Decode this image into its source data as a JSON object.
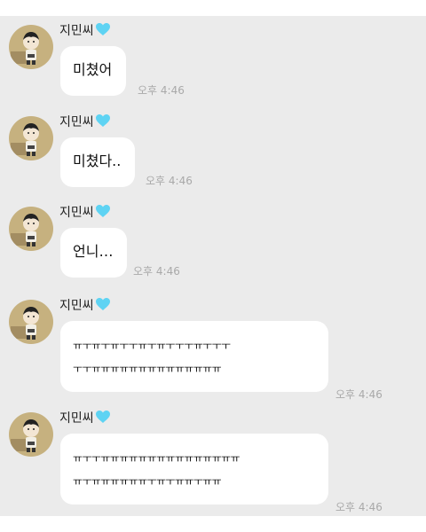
{
  "messages": [
    {
      "sender": "지민씨",
      "text": "미쳤어",
      "time": "오후 4:46"
    },
    {
      "sender": "지민씨",
      "text": "미쳤다..",
      "time": "오후 4:46"
    },
    {
      "sender": "지민씨",
      "text": "언니…",
      "time": "오후 4:46"
    },
    {
      "sender": "지민씨",
      "lines": [
        "ㅠㅜㅠㅜㅠㅜㅜㅠㅜㅠㅜㅜㅜㅠㅜㅜㅜ",
        "ㅜㅜㅠㅠㅠㅠㅠㅠㅠㅠㅠㅠㅠㅠㅠㅠ"
      ],
      "time": "오후 4:46"
    },
    {
      "sender": "지민씨",
      "lines": [
        "ㅠㅜㅜㅠㅠㅠㅠㅠㅠㅠㅠㅠㅠㅠㅠㅠㅠㅠ",
        "ㅠㅜㅠㅠㅠㅠㅠㅠㅜㅠㅜㅠㅠㅜㅠㅠ"
      ],
      "time": "오후 4:46"
    }
  ],
  "colors": {
    "background": "#ebebeb",
    "bubble": "#ffffff",
    "heart": "#5ed3f3",
    "timestamp": "#a9a9a9",
    "avatar_bg": "#c6b17f"
  },
  "icons": {
    "avatar": "avatar-icon",
    "heart": "heart-icon"
  }
}
